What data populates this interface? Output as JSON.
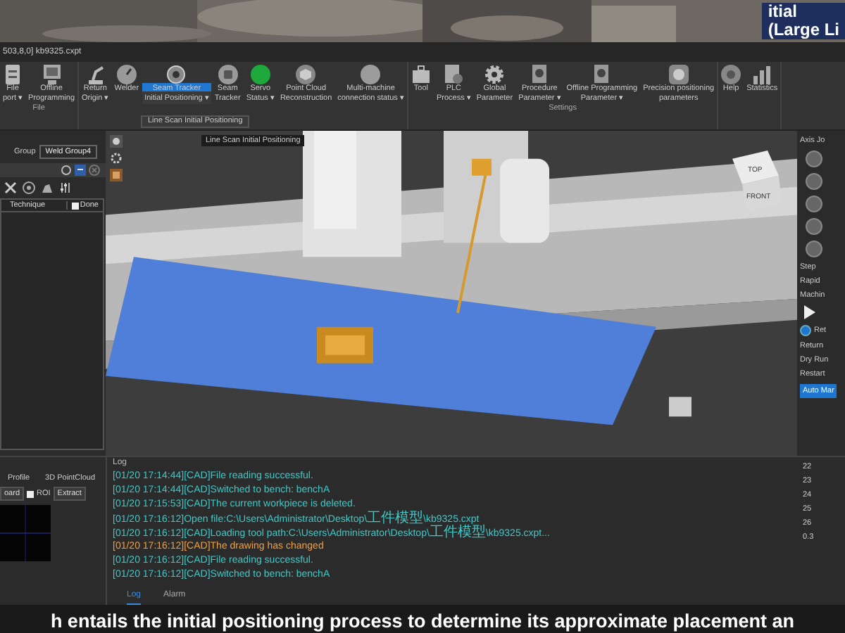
{
  "banner": {
    "title_lines": [
      "itial",
      "(Large Li"
    ]
  },
  "window": {
    "title": "503,8,0] kb9325.cxpt"
  },
  "ribbon": {
    "groups": [
      {
        "label": "File",
        "items": [
          {
            "kind": "doc",
            "lines": [
              "File",
              "port ▾"
            ],
            "selected": false
          },
          {
            "kind": "monitor",
            "lines": [
              "Offline",
              "Programming"
            ],
            "selected": false
          }
        ]
      },
      {
        "items": [
          {
            "kind": "robot",
            "lines": [
              "Return",
              "Origin ▾"
            ],
            "selected": false
          },
          {
            "kind": "gauge",
            "lines": [
              "Welder"
            ],
            "selected": false
          },
          {
            "kind": "target",
            "lines": [
              "Seam Tracker",
              "Initial Positioning ▾"
            ],
            "selected": true
          },
          {
            "kind": "tracker",
            "lines": [
              "Seam",
              "Tracker"
            ],
            "selected": false
          },
          {
            "kind": "status",
            "color": "#1fa83c",
            "lines": [
              "Servo",
              "Status ▾"
            ],
            "selected": false
          },
          {
            "kind": "cube",
            "lines": [
              "Point Cloud",
              "Reconstruction"
            ],
            "selected": false
          },
          {
            "kind": "status",
            "color": "#9c9c9c",
            "lines": [
              "Multi-machine",
              "connection status ▾"
            ],
            "selected": false
          }
        ]
      },
      {
        "label": "Settings",
        "items": [
          {
            "kind": "toolbox",
            "lines": [
              "Tool"
            ],
            "selected": false
          },
          {
            "kind": "plc",
            "lines": [
              "PLC",
              "Process ▾"
            ],
            "selected": false
          },
          {
            "kind": "gear",
            "lines": [
              "Global",
              "Parameter"
            ],
            "selected": false
          },
          {
            "kind": "docgear",
            "lines": [
              "Procedure",
              "Parameter ▾"
            ],
            "selected": false
          },
          {
            "kind": "docgear",
            "lines": [
              "Offline Programming",
              "Parameter ▾"
            ],
            "selected": false
          },
          {
            "kind": "dial",
            "lines": [
              "Precision positioning",
              "parameters"
            ],
            "selected": false
          }
        ]
      },
      {
        "items": [
          {
            "kind": "help",
            "lines": [
              "Help"
            ],
            "selected": false
          },
          {
            "kind": "chart",
            "lines": [
              "Statistics"
            ],
            "selected": false
          }
        ]
      }
    ]
  },
  "dropdown": {
    "item": "Line Scan Initial Positioning"
  },
  "tooltip": "Line Scan Initial Positioning",
  "left_panel": {
    "group_label": "Group",
    "group_value": "Weld Group4",
    "table": {
      "columns": [
        "Technique"
      ],
      "done": {
        "label": "Done",
        "checked": false
      }
    }
  },
  "view_cube": {
    "top": "TOP",
    "front": "FRONT"
  },
  "right_panel": {
    "title": "Axis Jo",
    "step": "Step",
    "rapid": "Rapid",
    "machine": "Machin",
    "radio": {
      "label": "Ret",
      "selected": true
    },
    "options": [
      "Return",
      "Dry Run",
      "Restart"
    ],
    "button": "Auto Mar"
  },
  "bottom_left": {
    "tabs": [
      "Profile",
      "3D PointCloud"
    ],
    "board_button": "oard",
    "roi": {
      "label": "ROI",
      "checked": false
    },
    "extract_button": "Extract"
  },
  "log": {
    "title": "Log",
    "lines": [
      {
        "kind": "info",
        "time": "[01/20 17:14:44]",
        "text": "[CAD]File reading successful."
      },
      {
        "kind": "info",
        "time": "[01/20 17:14:44]",
        "text": "[CAD]Switched to bench: benchA"
      },
      {
        "kind": "info",
        "time": "[01/20 17:15:53]",
        "text": "[CAD]The current workpiece is deleted."
      },
      {
        "kind": "info",
        "time": "[01/20 17:16:12]",
        "text": "Open file:C:\\Users\\Administrator\\Desktop\\工件模型\\kb9325.cxpt"
      },
      {
        "kind": "info",
        "time": "[01/20 17:16:12]",
        "text": "[CAD]Loading tool path:C:\\Users\\Administrator\\Desktop\\工件模型\\kb9325.cxpt..."
      },
      {
        "kind": "warning",
        "time": "[01/20 17:16:12]",
        "text": "[CAD]The drawing has changed"
      },
      {
        "kind": "info",
        "time": "[01/20 17:16:12]",
        "text": "[CAD]File reading successful."
      },
      {
        "kind": "info",
        "time": "[01/20 17:16:12]",
        "text": "[CAD]Switched to bench: benchA"
      }
    ],
    "tabs": [
      {
        "label": "Log",
        "selected": true
      },
      {
        "label": "Alarm",
        "selected": false
      }
    ]
  },
  "side_numbers": [
    "22",
    "23",
    "24",
    "25",
    "26",
    "0.3"
  ],
  "subtitle": "h entails the initial positioning process to determine its approximate placement an"
}
